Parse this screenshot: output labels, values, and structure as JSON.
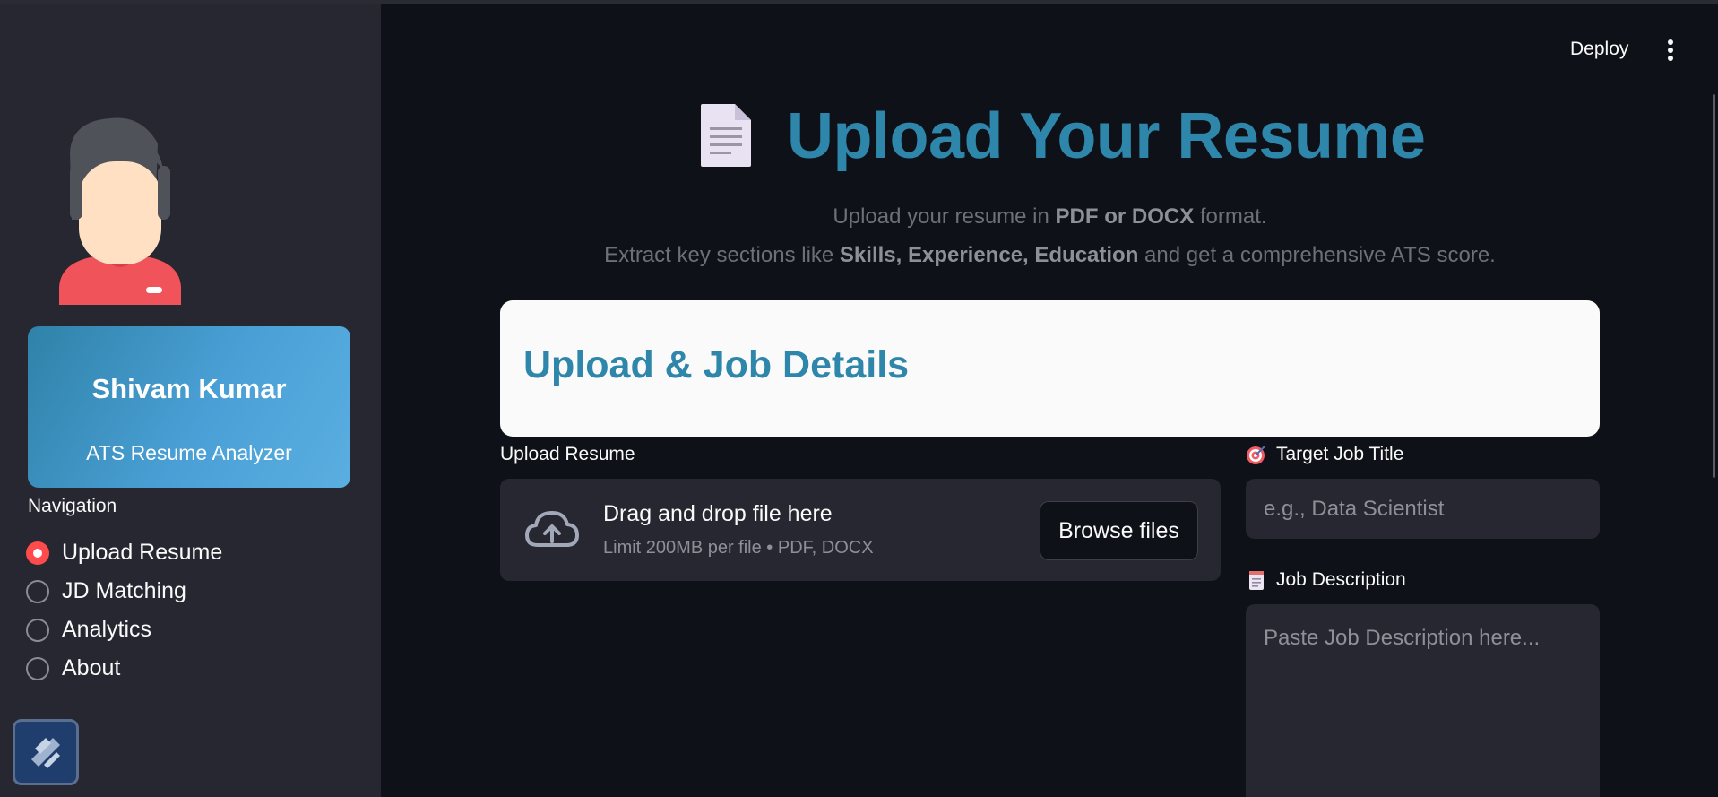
{
  "header": {
    "deploy_label": "Deploy",
    "menu_icon": "kebab-menu-icon"
  },
  "sidebar": {
    "profile": {
      "name": "Shivam Kumar",
      "subtitle": "ATS Resume Analyzer"
    },
    "navigation_heading": "Navigation",
    "nav_items": [
      {
        "label": "Upload Resume",
        "selected": true
      },
      {
        "label": "JD Matching",
        "selected": false
      },
      {
        "label": "Analytics",
        "selected": false
      },
      {
        "label": "About",
        "selected": false
      }
    ],
    "accent_color": "#ff4b4b"
  },
  "main": {
    "title": "Upload Your Resume",
    "title_icon": "document-icon",
    "intro_line1": {
      "pre": "Upload your resume in ",
      "bold": "PDF or DOCX",
      "post": " format."
    },
    "intro_line2": {
      "pre": "Extract key sections like ",
      "bold": "Skills, Experience, Education",
      "post": " and get a comprehensive ATS score."
    },
    "card_title": "Upload & Job Details",
    "upload": {
      "label": "Upload Resume",
      "drop_text": "Drag and drop file here",
      "limit_text": "Limit 200MB per file • PDF, DOCX",
      "browse_label": "Browse files"
    },
    "target_job": {
      "label": "Target Job Title",
      "icon": "target-icon",
      "placeholder": "e.g., Data Scientist",
      "value": ""
    },
    "job_description": {
      "label": "Job Description",
      "icon": "notepad-icon",
      "placeholder": "Paste Job Description here...",
      "value": ""
    },
    "brand_color": "#2e86ab"
  }
}
